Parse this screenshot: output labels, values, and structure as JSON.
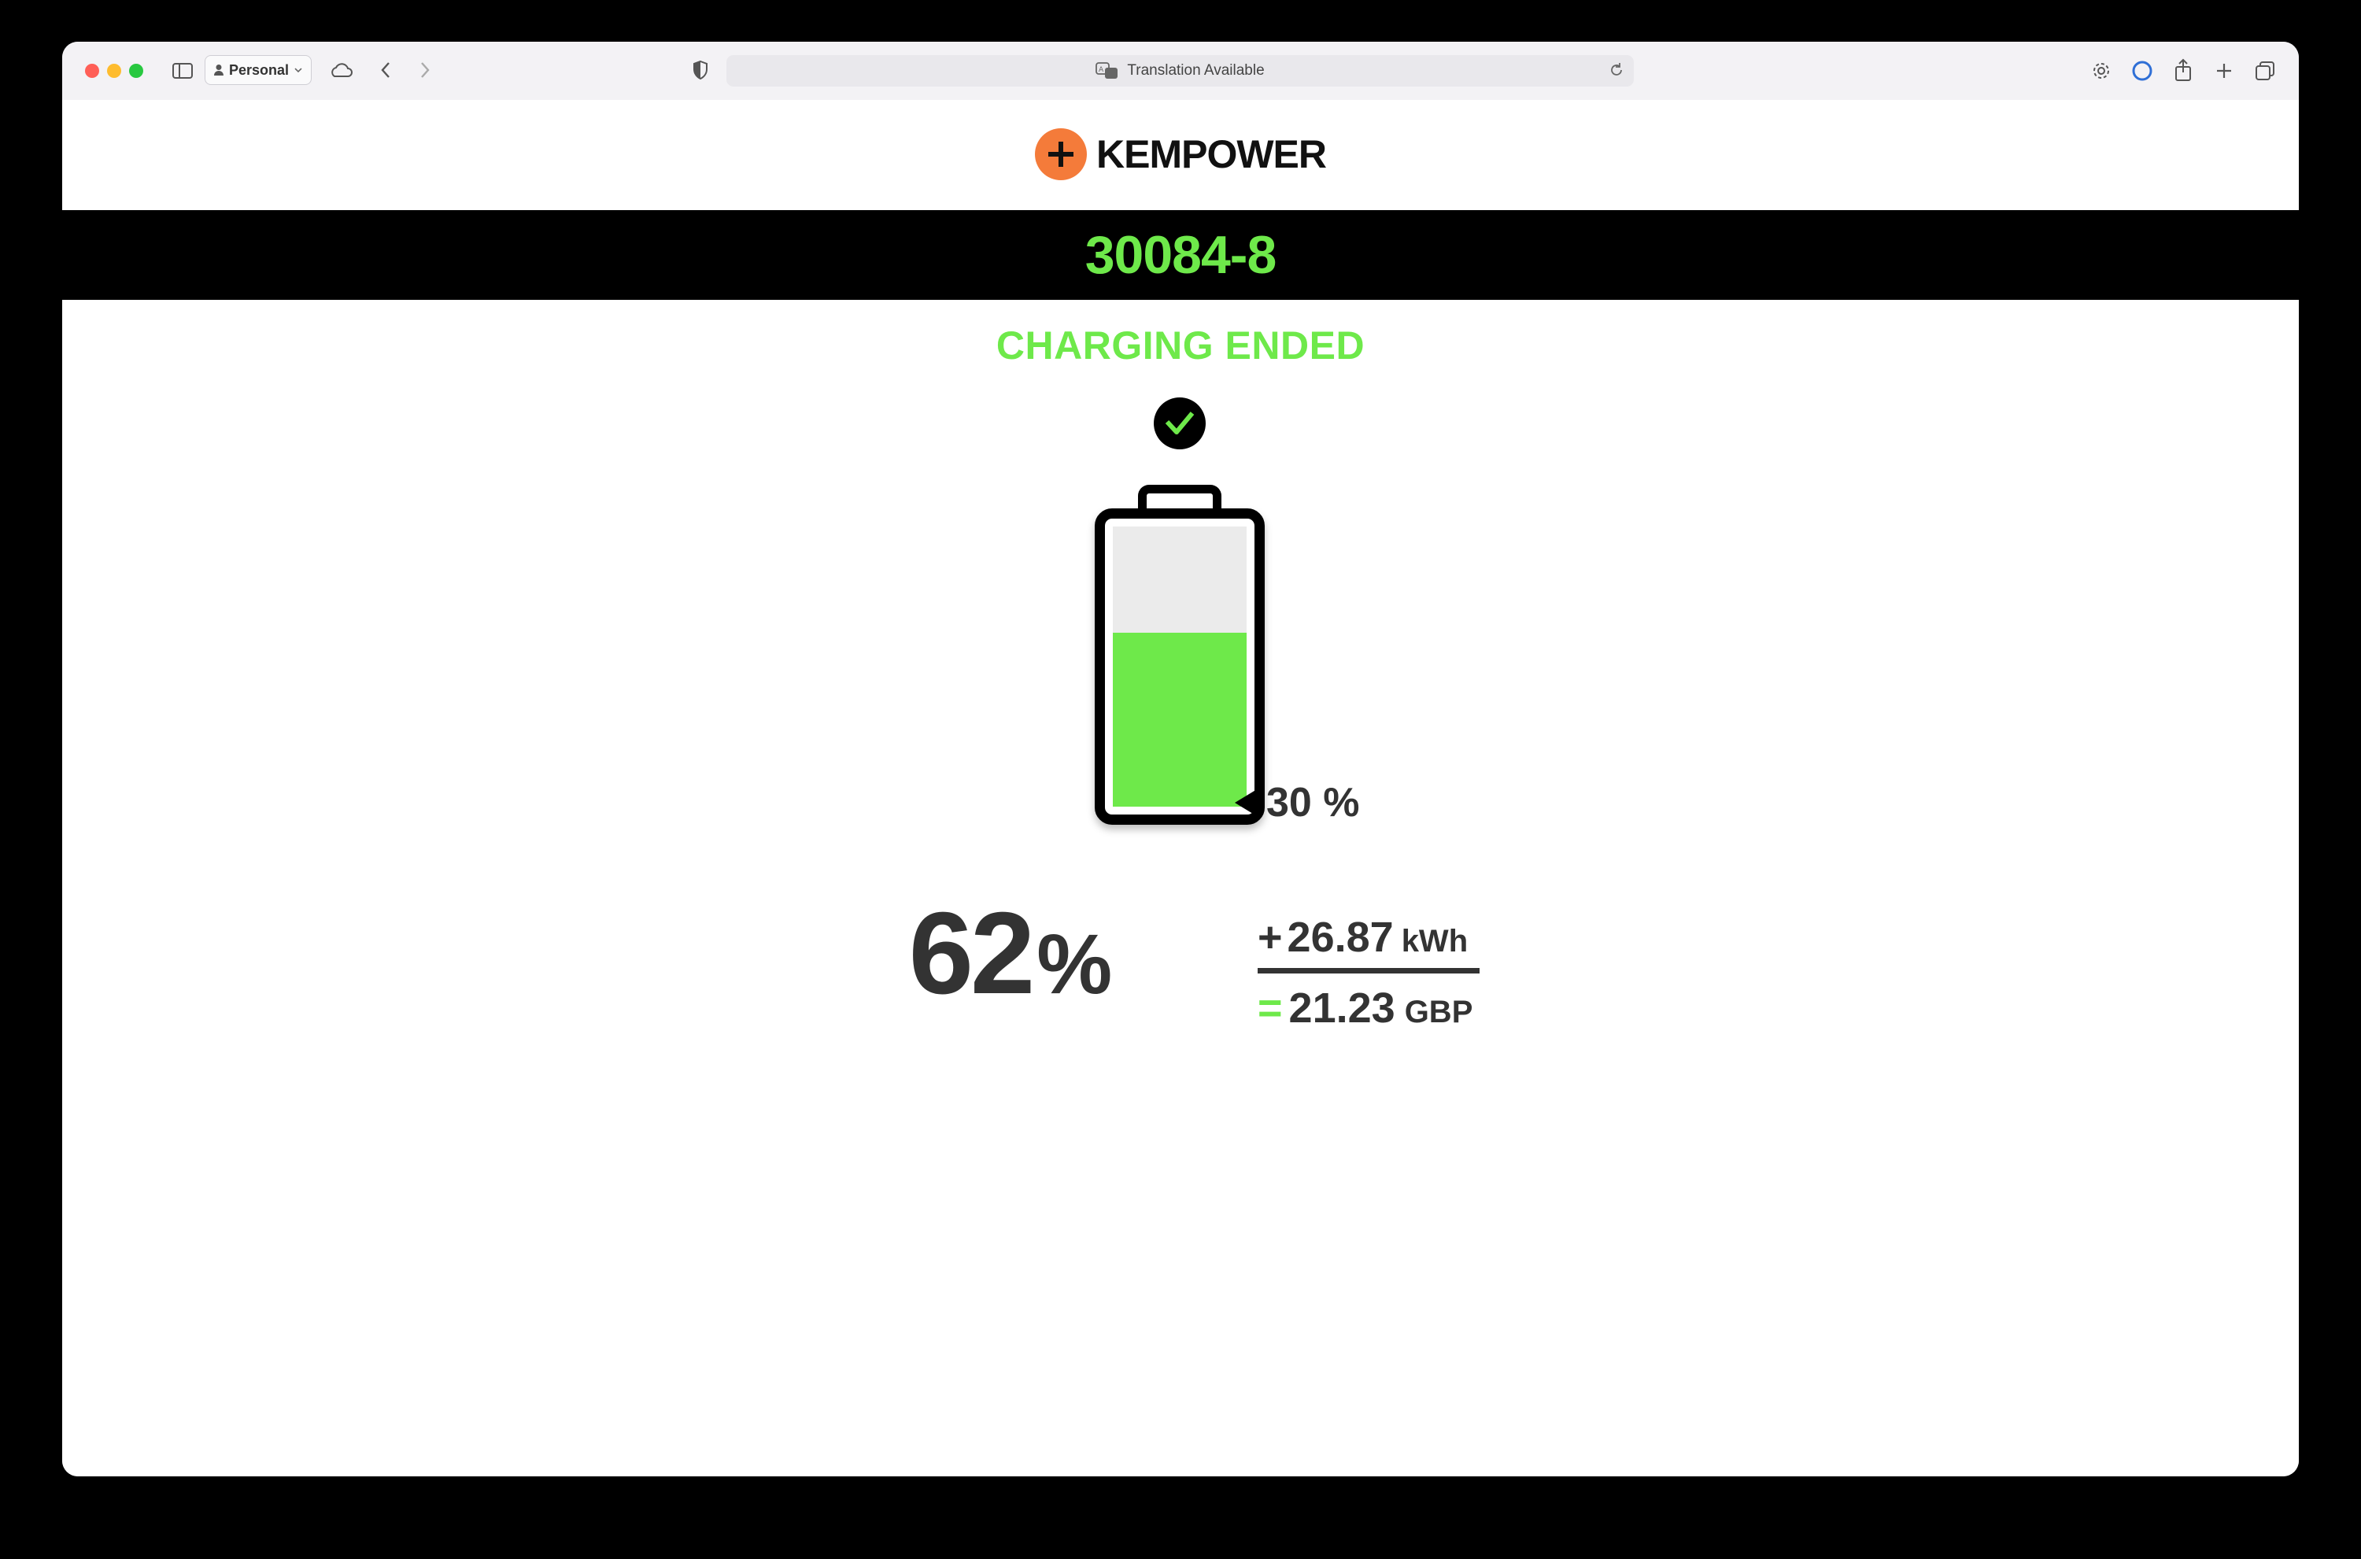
{
  "browser": {
    "profile_label": "Personal",
    "address_text": "Translation Available",
    "icons": [
      "sidebar-icon",
      "person-icon",
      "chevron-down-icon",
      "cloud-icon",
      "back-icon",
      "forward-icon",
      "shield-icon",
      "translate-icon",
      "reload-icon",
      "gear-icon",
      "extension-icon",
      "share-icon",
      "plus-icon",
      "tabs-icon"
    ]
  },
  "page": {
    "brand": "KEMPOWER",
    "charger_id": "30084-8",
    "status": "CHARGING ENDED",
    "start_soc_value": "30",
    "start_soc_unit": "%",
    "start_soc_fraction": 0.3,
    "soc_value": "62",
    "soc_unit": "%",
    "soc_fraction": 0.62,
    "energy_sign": "+",
    "energy_value": "26.87",
    "energy_unit": "kWh",
    "cost_sign": "=",
    "cost_value": "21.23",
    "cost_unit": "GBP"
  },
  "colors": {
    "accent_green": "#6ee94a",
    "brand_orange": "#f47b3a",
    "text_dark": "#333333"
  }
}
